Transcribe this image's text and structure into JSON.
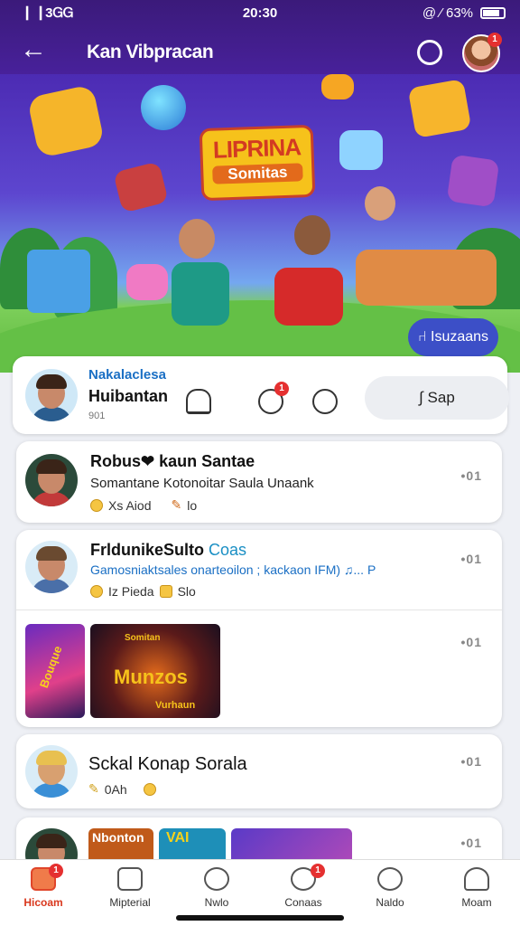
{
  "status_bar": {
    "signal": "▕▕ 3ᏀᏀ",
    "time": "20:30",
    "right": "@ ⁄ 63%"
  },
  "header": {
    "title": "Kan Vibpracan"
  },
  "banner": {
    "logo_line1": "LIPRINA",
    "logo_line2": "Somitas",
    "button_label": "⑁ Isuzaans"
  },
  "profile_card": {
    "link": "Nakalaclesa",
    "name": "Huibantan",
    "meta": "901",
    "action_label": "∫ Sap",
    "chat_badge": "1"
  },
  "posts": [
    {
      "name": "Robus❤ kaun Santae",
      "sub": "Somantane Kotonoitar Saula Unaank",
      "meta1": "Xs  Aiod",
      "meta2": "lo",
      "more": "•01"
    },
    {
      "name": "FrldunikeSulto",
      "name_suffix": "Coas",
      "sub": "Gamosniaktsales onarteoilon ; kackaon IFM) ♫... P",
      "meta1": "Iz  Pieda",
      "meta2": "Slo",
      "more": "•01"
    },
    {
      "more": "•01",
      "thumb1": "Bouque",
      "thumb2_top": "Somitan",
      "thumb2_main": "Munzos",
      "thumb2_bottom": "Vurhaun"
    },
    {
      "name": "Sckal Konap Sorala",
      "meta1": "0Ah",
      "more": "•01"
    },
    {
      "more": "•01",
      "thumb1": "Nbonton",
      "thumb2": "VAI"
    }
  ],
  "bottom_nav": [
    {
      "label": "Hicoam",
      "icon": "home-icon",
      "active": true,
      "badge": "1"
    },
    {
      "label": "Mipterial",
      "icon": "image-icon",
      "active": false
    },
    {
      "label": "Nwlo",
      "icon": "compass-icon",
      "active": false
    },
    {
      "label": "Conaas",
      "icon": "heart-icon",
      "active": false,
      "badge": "1"
    },
    {
      "label": "Naldo",
      "icon": "music-icon",
      "active": false
    },
    {
      "label": "Moam",
      "icon": "profile-icon",
      "active": false
    }
  ],
  "colors": {
    "header": "#3b1a7a",
    "accent": "#e0452a",
    "link": "#1a6fc4"
  }
}
